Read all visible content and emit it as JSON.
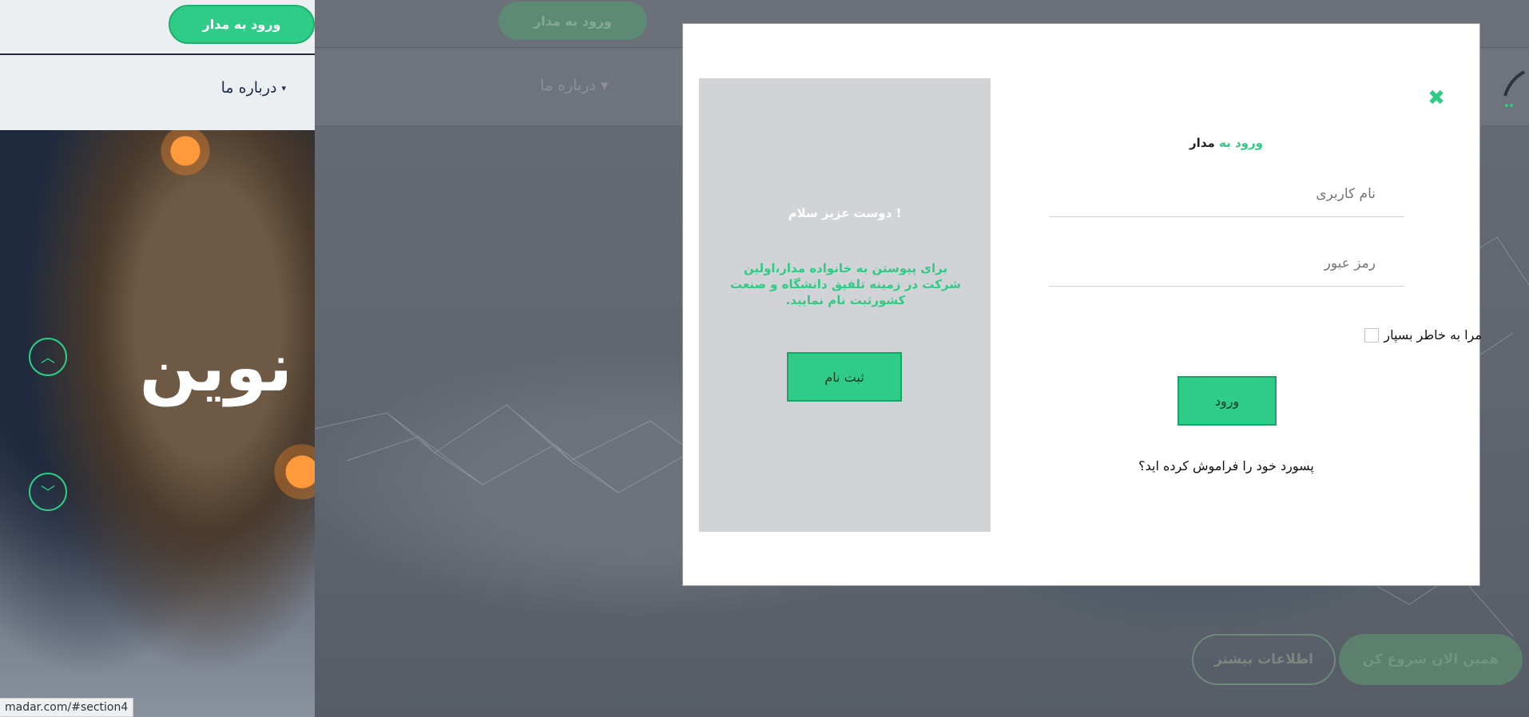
{
  "left_strip": {
    "login_button": "ورود به مدار",
    "about_label": "درباره ما",
    "hero_word": "نوین",
    "status_url": "madar.com/#section4"
  },
  "background": {
    "login_button": "ورود به مدار",
    "about_label": "درباره ما",
    "more_info": "اطلاعات بیشتر",
    "start_now": "همین الان شروع کن"
  },
  "modal": {
    "welcome": {
      "title": "دوست عزیز سلام !",
      "text": "برای پیوستن به خانواده مدار،اولین شرکت در زمینه تلفیق دانشگاه و صنعت کشورثبت نام نمایید.",
      "register_button": "ثبت نام"
    },
    "login": {
      "title_green": "ورود به",
      "title_dark": "مدار",
      "username_placeholder": "نام کاربری",
      "password_placeholder": "رمز عبور",
      "remember_label": "مرا به خاطر بسپار",
      "submit_button": "ورود",
      "forgot_password": "پسورد خود را فراموش کرده اید؟"
    }
  },
  "colors": {
    "accent": "#2ecc86",
    "overlay": "#6b7079"
  },
  "icons": {
    "close": "close-icon",
    "chevron_up": "chevron-up-icon",
    "chevron_down": "chevron-down-icon",
    "caret": "caret-down-icon"
  }
}
